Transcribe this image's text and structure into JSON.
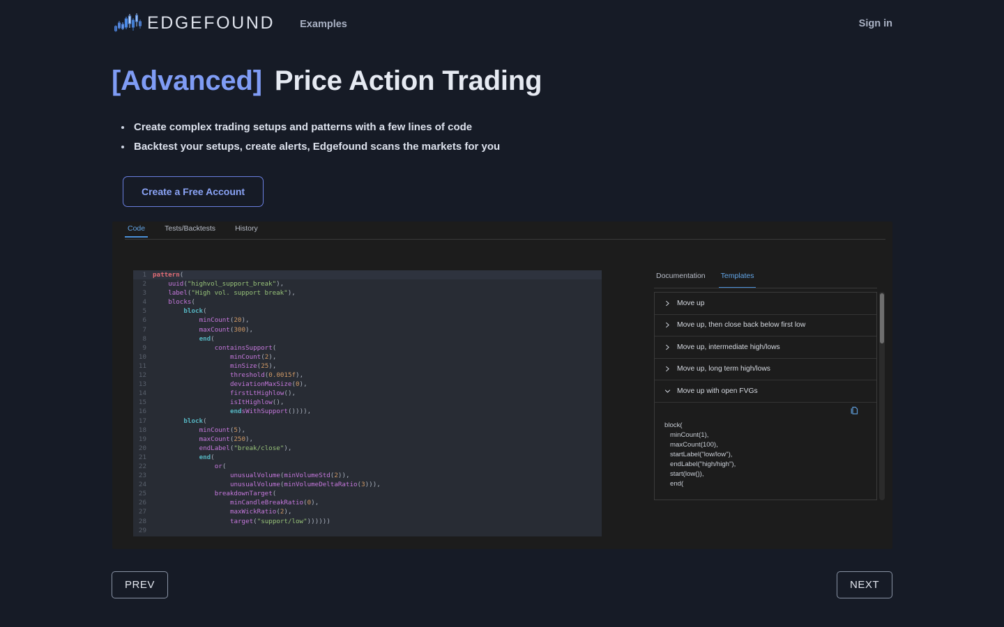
{
  "header": {
    "brand": "EDGEFOUND",
    "nav_examples": "Examples",
    "sign_in": "Sign in"
  },
  "hero": {
    "title_tag": "[Advanced]",
    "title_main": "Price Action Trading",
    "bullets": [
      "Create complex trading setups and patterns with a few lines of code",
      "Backtest your setups, create alerts, Edgefound scans the markets for you"
    ],
    "cta_label": "Create a Free Account"
  },
  "editor_tabs": [
    {
      "label": "Code",
      "active": true
    },
    {
      "label": "Tests/Backtests",
      "active": false
    },
    {
      "label": "History",
      "active": false
    }
  ],
  "code": {
    "lines": [
      {
        "n": "1",
        "t": "pattern("
      },
      {
        "n": "2",
        "t": "    uuid(\"highvol_support_break\"),"
      },
      {
        "n": "3",
        "t": "    label(\"High vol. support break\"),"
      },
      {
        "n": "4",
        "t": "    blocks("
      },
      {
        "n": "5",
        "t": "        block("
      },
      {
        "n": "6",
        "t": "            minCount(20),"
      },
      {
        "n": "7",
        "t": "            maxCount(300),"
      },
      {
        "n": "8",
        "t": "            end("
      },
      {
        "n": "9",
        "t": "                containsSupport("
      },
      {
        "n": "10",
        "t": "                    minCount(2),"
      },
      {
        "n": "11",
        "t": "                    minSize(25),"
      },
      {
        "n": "12",
        "t": "                    threshold(0.0015f),"
      },
      {
        "n": "13",
        "t": "                    deviationMaxSize(0),"
      },
      {
        "n": "14",
        "t": "                    firstLtHighlow(),"
      },
      {
        "n": "15",
        "t": "                    isItHighlow(),"
      },
      {
        "n": "16",
        "t": "                    endsWithSupport()))),"
      },
      {
        "n": "17",
        "t": "        block("
      },
      {
        "n": "18",
        "t": "            minCount(5),"
      },
      {
        "n": "19",
        "t": "            maxCount(250),"
      },
      {
        "n": "20",
        "t": "            endLabel(\"break/close\"),"
      },
      {
        "n": "21",
        "t": "            end("
      },
      {
        "n": "22",
        "t": "                or("
      },
      {
        "n": "23",
        "t": "                    unusualVolume(minVolumeStd(2)),"
      },
      {
        "n": "24",
        "t": "                    unusualVolume(minVolumeDeltaRatio(3))),"
      },
      {
        "n": "25",
        "t": "                breakdownTarget("
      },
      {
        "n": "26",
        "t": "                    minCandleBreakRatio(0),"
      },
      {
        "n": "27",
        "t": "                    maxWickRatio(2),"
      },
      {
        "n": "28",
        "t": "                    target(\"support/low\"))))))"
      },
      {
        "n": "29",
        "t": ""
      }
    ]
  },
  "right_panel": {
    "tabs": [
      {
        "label": "Documentation",
        "active": false
      },
      {
        "label": "Templates",
        "active": true
      }
    ],
    "templates": [
      {
        "label": "Move up",
        "expanded": false
      },
      {
        "label": "Move up, then close back below first low",
        "expanded": false
      },
      {
        "label": "Move up, intermediate high/lows",
        "expanded": false
      },
      {
        "label": "Move up, long term high/lows",
        "expanded": false
      },
      {
        "label": "Move up with open FVGs",
        "expanded": true
      }
    ],
    "expanded_code": "block(\n   minCount(1),\n   maxCount(100),\n   startLabel(\"low/low\"),\n   endLabel(\"high/high\"),\n   start(low()),\n   end(",
    "copy_icon": "copy-icon"
  },
  "pager": {
    "prev": "PREV",
    "next": "NEXT"
  },
  "colors": {
    "page_bg": "#161b26",
    "accent_blue": "#7f9cf5",
    "tab_active": "#63a6e8",
    "editor_bg": "#282c34",
    "panel_bg": "#1c1c1c"
  }
}
